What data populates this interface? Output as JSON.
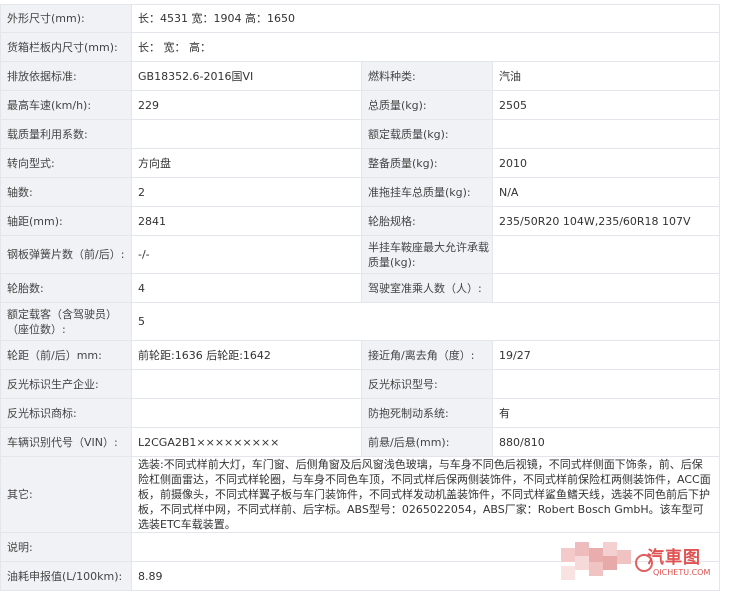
{
  "rows": [
    {
      "label": "外形尺寸(mm):",
      "value": "长：4531 宽：1904 高：1650"
    },
    {
      "label": "货箱栏板内尺寸(mm):",
      "value": "长：  宽：  高："
    },
    {
      "label": "排放依据标准:",
      "value": "GB18352.6-2016国VI",
      "label2": "燃料种类:",
      "value2": "汽油"
    },
    {
      "label": "最高车速(km/h):",
      "value": "229",
      "label2": "总质量(kg):",
      "value2": "2505"
    },
    {
      "label": "载质量利用系数:",
      "value": "",
      "label2": "额定载质量(kg):",
      "value2": ""
    },
    {
      "label": "转向型式:",
      "value": "方向盘",
      "label2": "整备质量(kg):",
      "value2": "2010"
    },
    {
      "label": "轴数:",
      "value": "2",
      "label2": "准拖挂车总质量(kg):",
      "value2": "N/A"
    },
    {
      "label": "轴距(mm):",
      "value": "2841",
      "label2": "轮胎规格:",
      "value2": "235/50R20 104W,235/60R18 107V"
    },
    {
      "label": "钢板弹簧片数（前/后）:",
      "value": "-/-",
      "label2": "半挂车鞍座最大允许承载质量(kg):",
      "value2": ""
    },
    {
      "label": "轮胎数:",
      "value": "4",
      "label2": "驾驶室准乘人数（人）:",
      "value2": ""
    },
    {
      "label": "额定载客（含驾驶员）（座位数）:",
      "value": "5"
    },
    {
      "label": "轮距（前/后）mm:",
      "value": "前轮距:1636 后轮距:1642",
      "label2": "接近角/离去角（度）:",
      "value2": "19/27"
    },
    {
      "label": "反光标识生产企业:",
      "value": "",
      "label2": "反光标识型号:",
      "value2": ""
    },
    {
      "label": "反光标识商标:",
      "value": "",
      "label2": "防抱死制动系统:",
      "value2": "有"
    },
    {
      "label": "车辆识别代号（VIN）:",
      "value": "L2CGA2B1×××××××××",
      "label2": "前悬/后悬(mm):",
      "value2": "880/810"
    },
    {
      "label": "其它:",
      "value": "选装:不同式样前大灯，车门窗、后侧角窗及后风窗浅色玻璃，与车身不同色后视镜，不同式样侧面下饰条，前、后保险杠侧面雷达，不同式样轮圈，与车身不同色车顶，不同式样后保两侧装饰件，不同式样前保险杠两侧装饰件，ACC面板，前摄像头，不同式样翼子板与车门装饰件，不同式样发动机盖装饰件，不同式样鲨鱼鳍天线，选装不同色前后下护板，不同式样中网，不同式样前、后字标。ABS型号：0265022054，ABS厂家：Robert Bosch GmbH。该车型可选装ETC车载装置。"
    },
    {
      "label": "说明:",
      "value": ""
    },
    {
      "label": "油耗申报值(L/100km):",
      "value": "8.89"
    }
  ],
  "watermark": {
    "brand": "汽車图",
    "url": "QICHETU.COM"
  },
  "colors": {
    "label_bg": "#f0f2f5",
    "border": "#e3e6ea",
    "watermark": "#e05252"
  }
}
